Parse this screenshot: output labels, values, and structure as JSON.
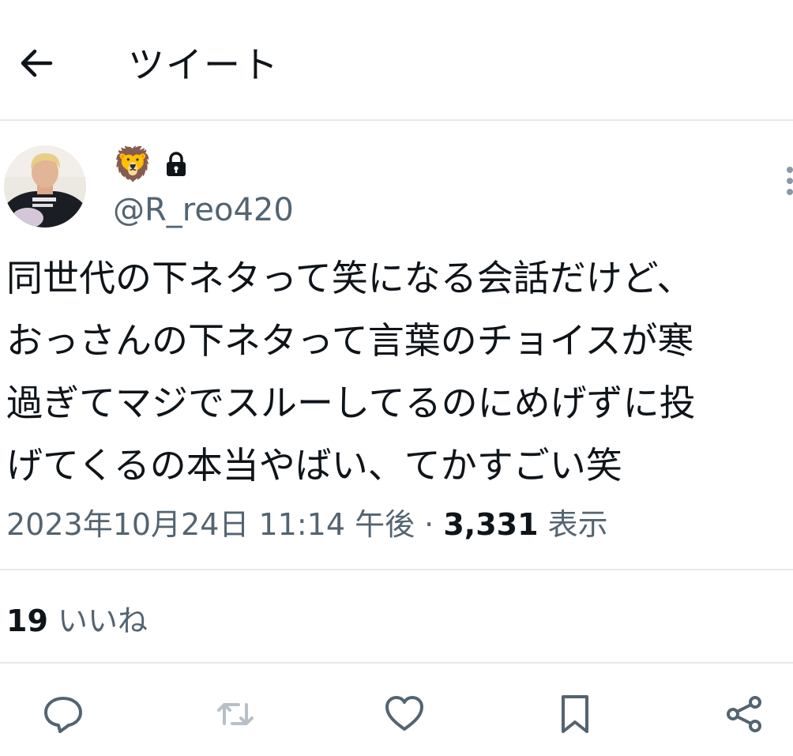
{
  "header": {
    "title": "ツイート",
    "back_icon": "arrow-left-icon"
  },
  "tweet": {
    "author": {
      "display_name": "🦁",
      "protected_icon": "lock-icon",
      "handle": "@R_reo420"
    },
    "text": "同世代の下ネタって笑になる会話だけど、\nおっさんの下ネタって言葉のチョイスが寒\n過ぎてマジでスルーしてるのにめげずに投\nげてくるの本当やばい、てかすごい笑",
    "timestamp": "2023年10月24日 11:14 午後",
    "separator": " · ",
    "views_count": "3,331",
    "views_label": "表示",
    "likes_count": "19",
    "likes_label": "いいね"
  },
  "actions": [
    {
      "name": "reply",
      "icon": "reply-icon"
    },
    {
      "name": "retweet",
      "icon": "retweet-icon"
    },
    {
      "name": "like",
      "icon": "heart-icon"
    },
    {
      "name": "bookmark",
      "icon": "bookmark-icon"
    },
    {
      "name": "share",
      "icon": "share-icon"
    }
  ],
  "colors": {
    "primary_text": "#0f1419",
    "secondary_text": "#536471",
    "divider": "#e6e8ea"
  }
}
